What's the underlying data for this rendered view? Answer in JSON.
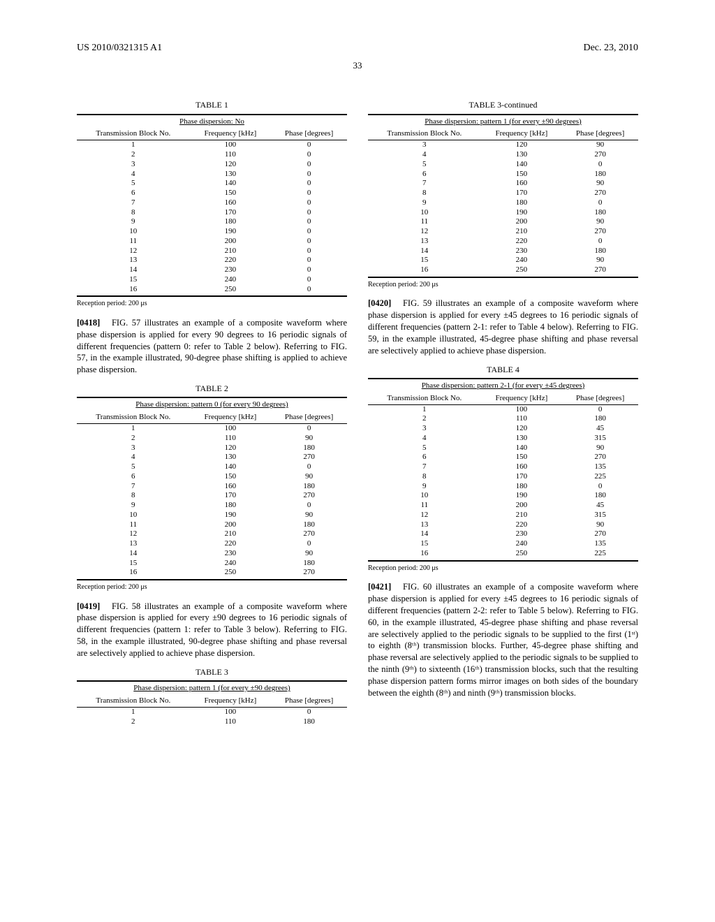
{
  "header": {
    "pubnum": "US 2010/0321315 A1",
    "date": "Dec. 23, 2010",
    "pagenum": "33"
  },
  "col_headers": {
    "block": "Transmission Block No.",
    "freq": "Frequency [kHz]",
    "phase": "Phase [degrees]"
  },
  "footnote": "Reception period: 200 μs",
  "tables": {
    "t1": {
      "label": "TABLE 1",
      "subtitle": "Phase dispersion: No",
      "rows": [
        [
          "1",
          "100",
          "0"
        ],
        [
          "2",
          "110",
          "0"
        ],
        [
          "3",
          "120",
          "0"
        ],
        [
          "4",
          "130",
          "0"
        ],
        [
          "5",
          "140",
          "0"
        ],
        [
          "6",
          "150",
          "0"
        ],
        [
          "7",
          "160",
          "0"
        ],
        [
          "8",
          "170",
          "0"
        ],
        [
          "9",
          "180",
          "0"
        ],
        [
          "10",
          "190",
          "0"
        ],
        [
          "11",
          "200",
          "0"
        ],
        [
          "12",
          "210",
          "0"
        ],
        [
          "13",
          "220",
          "0"
        ],
        [
          "14",
          "230",
          "0"
        ],
        [
          "15",
          "240",
          "0"
        ],
        [
          "16",
          "250",
          "0"
        ]
      ]
    },
    "t2": {
      "label": "TABLE 2",
      "subtitle": "Phase dispersion: pattern 0 (for every 90 degrees)",
      "rows": [
        [
          "1",
          "100",
          "0"
        ],
        [
          "2",
          "110",
          "90"
        ],
        [
          "3",
          "120",
          "180"
        ],
        [
          "4",
          "130",
          "270"
        ],
        [
          "5",
          "140",
          "0"
        ],
        [
          "6",
          "150",
          "90"
        ],
        [
          "7",
          "160",
          "180"
        ],
        [
          "8",
          "170",
          "270"
        ],
        [
          "9",
          "180",
          "0"
        ],
        [
          "10",
          "190",
          "90"
        ],
        [
          "11",
          "200",
          "180"
        ],
        [
          "12",
          "210",
          "270"
        ],
        [
          "13",
          "220",
          "0"
        ],
        [
          "14",
          "230",
          "90"
        ],
        [
          "15",
          "240",
          "180"
        ],
        [
          "16",
          "250",
          "270"
        ]
      ]
    },
    "t3a": {
      "label": "TABLE 3",
      "subtitle": "Phase dispersion: pattern 1 (for every ±90 degrees)",
      "rows": [
        [
          "1",
          "100",
          "0"
        ],
        [
          "2",
          "110",
          "180"
        ]
      ]
    },
    "t3b": {
      "label": "TABLE 3-continued",
      "subtitle": "Phase dispersion: pattern 1 (for every ±90 degrees)",
      "rows": [
        [
          "3",
          "120",
          "90"
        ],
        [
          "4",
          "130",
          "270"
        ],
        [
          "5",
          "140",
          "0"
        ],
        [
          "6",
          "150",
          "180"
        ],
        [
          "7",
          "160",
          "90"
        ],
        [
          "8",
          "170",
          "270"
        ],
        [
          "9",
          "180",
          "0"
        ],
        [
          "10",
          "190",
          "180"
        ],
        [
          "11",
          "200",
          "90"
        ],
        [
          "12",
          "210",
          "270"
        ],
        [
          "13",
          "220",
          "0"
        ],
        [
          "14",
          "230",
          "180"
        ],
        [
          "15",
          "240",
          "90"
        ],
        [
          "16",
          "250",
          "270"
        ]
      ]
    },
    "t4": {
      "label": "TABLE 4",
      "subtitle": "Phase dispersion: pattern 2-1 (for every ±45 degrees)",
      "rows": [
        [
          "1",
          "100",
          "0"
        ],
        [
          "2",
          "110",
          "180"
        ],
        [
          "3",
          "120",
          "45"
        ],
        [
          "4",
          "130",
          "315"
        ],
        [
          "5",
          "140",
          "90"
        ],
        [
          "6",
          "150",
          "270"
        ],
        [
          "7",
          "160",
          "135"
        ],
        [
          "8",
          "170",
          "225"
        ],
        [
          "9",
          "180",
          "0"
        ],
        [
          "10",
          "190",
          "180"
        ],
        [
          "11",
          "200",
          "45"
        ],
        [
          "12",
          "210",
          "315"
        ],
        [
          "13",
          "220",
          "90"
        ],
        [
          "14",
          "230",
          "270"
        ],
        [
          "15",
          "240",
          "135"
        ],
        [
          "16",
          "250",
          "225"
        ]
      ]
    }
  },
  "paras": {
    "p0418": {
      "num": "[0418]",
      "text": "FIG. 57 illustrates an example of a composite waveform where phase dispersion is applied for every 90 degrees to 16 periodic signals of different frequencies (pattern 0: refer to Table 2 below). Referring to FIG. 57, in the example illustrated, 90-degree phase shifting is applied to achieve phase dispersion."
    },
    "p0419": {
      "num": "[0419]",
      "text": "FIG. 58 illustrates an example of a composite waveform where phase dispersion is applied for every ±90 degrees to 16 periodic signals of different frequencies (pattern 1: refer to Table 3 below). Referring to FIG. 58, in the example illustrated, 90-degree phase shifting and phase reversal are selectively applied to achieve phase dispersion."
    },
    "p0420": {
      "num": "[0420]",
      "text": "FIG. 59 illustrates an example of a composite waveform where phase dispersion is applied for every ±45 degrees to 16 periodic signals of different frequencies (pattern 2-1: refer to Table 4 below). Referring to FIG. 59, in the example illustrated, 45-degree phase shifting and phase reversal are selectively applied to achieve phase dispersion."
    },
    "p0421": {
      "num": "[0421]",
      "text": "FIG. 60 illustrates an example of a composite waveform where phase dispersion is applied for every ±45 degrees to 16 periodic signals of different frequencies (pattern 2-2: refer to Table 5 below). Referring to FIG. 60, in the example illustrated, 45-degree phase shifting and phase reversal are selectively applied to the periodic signals to be supplied to the first (1ˢᵗ) to eighth (8ᵗʰ) transmission blocks. Further, 45-degree phase shifting and phase reversal are selectively applied to the periodic signals to be supplied to the ninth (9ᵗʰ) to sixteenth (16ᵗʰ) transmission blocks, such that the resulting phase dispersion pattern forms mirror images on both sides of the boundary between the eighth (8ᵗʰ) and ninth (9ᵗʰ) transmission blocks."
    }
  }
}
